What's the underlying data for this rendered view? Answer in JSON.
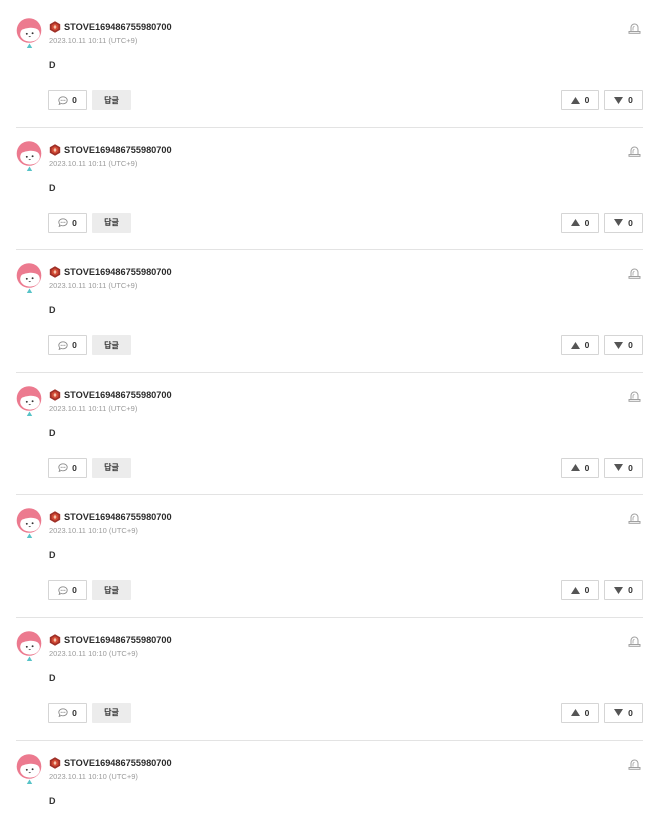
{
  "comments": [
    {
      "author": "STOVE169486755980700",
      "timestamp": "2023.10.11 10:11 (UTC+9)",
      "content": "D",
      "comment_count": 0,
      "reply_label": "답글",
      "upvotes": 0,
      "downvotes": 0
    },
    {
      "author": "STOVE169486755980700",
      "timestamp": "2023.10.11 10:11 (UTC+9)",
      "content": "D",
      "comment_count": 0,
      "reply_label": "답글",
      "upvotes": 0,
      "downvotes": 0
    },
    {
      "author": "STOVE169486755980700",
      "timestamp": "2023.10.11 10:11 (UTC+9)",
      "content": "D",
      "comment_count": 0,
      "reply_label": "답글",
      "upvotes": 0,
      "downvotes": 0
    },
    {
      "author": "STOVE169486755980700",
      "timestamp": "2023.10.11 10:11 (UTC+9)",
      "content": "D",
      "comment_count": 0,
      "reply_label": "답글",
      "upvotes": 0,
      "downvotes": 0
    },
    {
      "author": "STOVE169486755980700",
      "timestamp": "2023.10.11 10:10 (UTC+9)",
      "content": "D",
      "comment_count": 0,
      "reply_label": "답글",
      "upvotes": 0,
      "downvotes": 0
    },
    {
      "author": "STOVE169486755980700",
      "timestamp": "2023.10.11 10:10 (UTC+9)",
      "content": "D",
      "comment_count": 0,
      "reply_label": "답글",
      "upvotes": 0,
      "downvotes": 0
    },
    {
      "author": "STOVE169486755980700",
      "timestamp": "2023.10.11 10:10 (UTC+9)",
      "content": "D"
    }
  ],
  "icons": {
    "avatar": "profile-avatar",
    "author_badge": "hexagon-badge-icon",
    "report": "report-siren-icon",
    "comment_count": "speech-bubble-icon",
    "upvote": "triangle-up-icon",
    "downvote": "triangle-down-icon"
  },
  "colors": {
    "avatar_hair": "#ec7a8f",
    "avatar_shirt": "#57c3c7",
    "badge": "#b53a2b",
    "divider": "#e3e3e3",
    "reply_button_bg": "#ececec",
    "text": "#333333",
    "muted_text": "#9a9a9a"
  }
}
